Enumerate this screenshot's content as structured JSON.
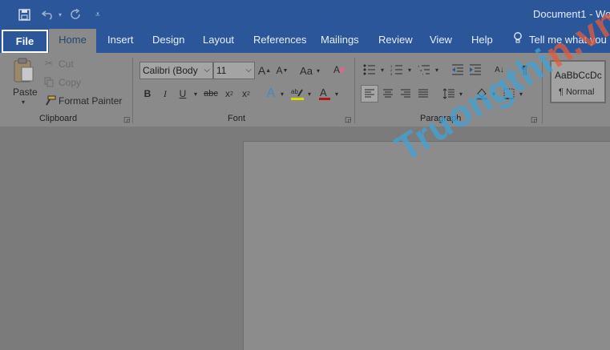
{
  "titlebar": {
    "document_title": "Document1 - Wo",
    "qat": {
      "save_icon": "save-icon",
      "undo_icon": "undo-icon",
      "redo_icon": "redo-icon",
      "customize_icon": "dropdown-icon"
    }
  },
  "tabs": {
    "file": "File",
    "items": [
      "Home",
      "Insert",
      "Design",
      "Layout",
      "References",
      "Mailings",
      "Review",
      "View",
      "Help"
    ],
    "active": "Home",
    "tell_me": "Tell me what you"
  },
  "clipboard": {
    "paste": "Paste",
    "cut": "Cut",
    "copy": "Copy",
    "format_painter": "Format Painter",
    "group_label": "Clipboard"
  },
  "font": {
    "font_name": "Calibri (Body",
    "font_size": "11",
    "grow": "A",
    "shrink": "A",
    "case": "Aa",
    "bold": "B",
    "italic": "I",
    "underline": "U",
    "strike": "abc",
    "subscript": "x",
    "superscript": "x",
    "group_label": "Font"
  },
  "paragraph": {
    "show_marks": "¶",
    "group_label": "Paragraph"
  },
  "styles": {
    "preview": "AaBbCcDc",
    "name": "¶ Normal"
  },
  "watermark": {
    "text": "Truongthi",
    "suffix": "n.vn"
  },
  "colors": {
    "title_blue": "#2b579a",
    "ribbon": "#8a8a8a",
    "canvas": "#7b7b7b"
  }
}
